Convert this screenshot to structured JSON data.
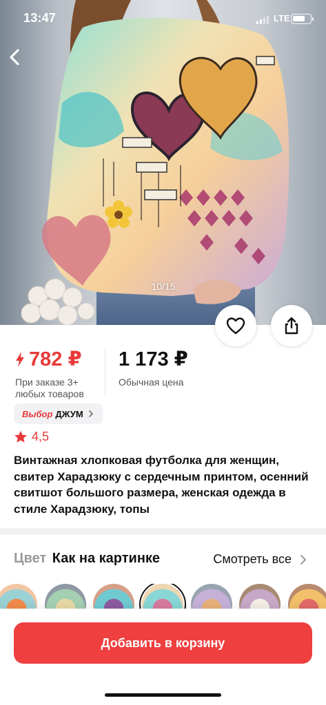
{
  "status_bar": {
    "time": "13:47",
    "network": "LTE"
  },
  "gallery": {
    "counter": "10/15"
  },
  "price": {
    "sale": "782 ₽",
    "sale_note": "При заказе 3+ любых товаров",
    "regular": "1 173 ₽",
    "regular_label": "Обычная цена"
  },
  "choice_badge": {
    "brand": "Выбор",
    "name": "ДЖУМ"
  },
  "rating": {
    "value": "4,5"
  },
  "product": {
    "title": "Винтажная хлопковая футболка для женщин, свитер Харадзюку с сердечным принтом, осенний свитшот большого размера, женская одежда в стиле Харадзюку, топы"
  },
  "colors": {
    "label": "Цвет",
    "selected": "Как на картинке",
    "see_all": "Смотреть все"
  },
  "cart": {
    "button_label": "Добавить в корзину"
  },
  "accent_color": "#ef3f3f",
  "icons": [
    "chevron-left-icon",
    "heart-icon",
    "share-icon",
    "lightning-icon",
    "star-icon",
    "chevron-right-icon"
  ]
}
